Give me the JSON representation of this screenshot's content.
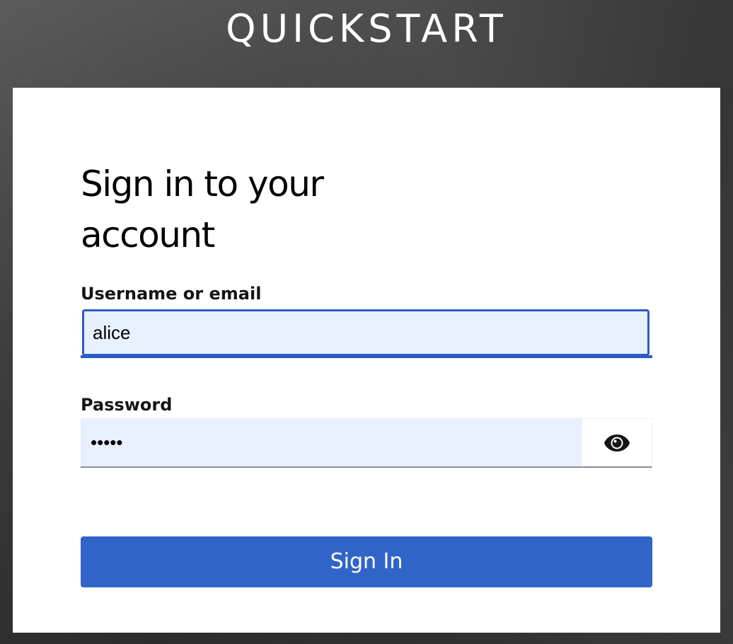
{
  "brand": {
    "title": "QUICKSTART"
  },
  "login": {
    "heading": "Sign in to your account",
    "username": {
      "label": "Username or email",
      "value": "alice"
    },
    "password": {
      "label": "Password",
      "value": "•••••",
      "toggle_icon": "eye-icon"
    },
    "submit_label": "Sign In"
  },
  "colors": {
    "accent": "#3064c8",
    "field_focus_border": "#2b5cc5",
    "field_fill": "#e8f0fe",
    "background": "#3b3b3b",
    "card": "#ffffff"
  }
}
